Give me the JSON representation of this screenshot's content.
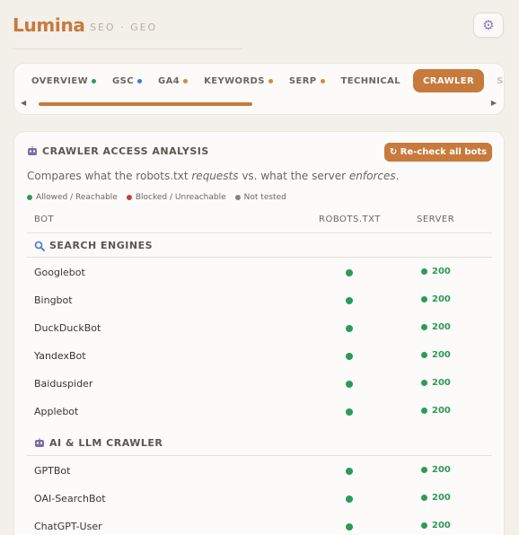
{
  "app": {
    "brand": "Lumina",
    "tagline": "SEO · GEO"
  },
  "tabs": [
    {
      "label": "OVERVIEW",
      "dot": "#2e9a57",
      "active": false
    },
    {
      "label": "GSC",
      "dot": "#3a7bd5",
      "active": false
    },
    {
      "label": "GA4",
      "dot": "#d28a3e",
      "active": false
    },
    {
      "label": "KEYWORDS",
      "dot": "#d28a3e",
      "active": false
    },
    {
      "label": "SERP",
      "dot": "#d28a3e",
      "active": false
    },
    {
      "label": "TECHNICAL",
      "dot": null,
      "active": false
    },
    {
      "label": "CRAWLER",
      "dot": null,
      "active": true
    },
    {
      "label": "SCI",
      "dot": null,
      "active": false
    }
  ],
  "tab_scroll": {
    "position": 0.45
  },
  "crawler": {
    "title": "CRAWLER ACCESS ANALYSIS",
    "recheck_button": "↻ Re-check all bots",
    "description_pre": "Compares what the robots.txt ",
    "description_requests": "requests",
    "description_mid": " vs. what the server ",
    "description_enforces": "enforces",
    "description_post": ".",
    "legend": [
      {
        "label": "Allowed / Reachable",
        "color": "#2e9a57"
      },
      {
        "label": "Blocked / Unreachable",
        "color": "#c0443a"
      },
      {
        "label": "Not tested",
        "color": "#8a837d"
      }
    ],
    "columns": {
      "bot": "BOT",
      "robots": "ROBOTS.TXT",
      "server": "SERVER"
    },
    "groups": [
      {
        "name": "SEARCH ENGINES",
        "icon": "magnifier-icon",
        "bots": [
          {
            "name": "Googlebot",
            "robots": "allowed",
            "server": "200"
          },
          {
            "name": "Bingbot",
            "robots": "allowed",
            "server": "200"
          },
          {
            "name": "DuckDuckBot",
            "robots": "allowed",
            "server": "200"
          },
          {
            "name": "YandexBot",
            "robots": "allowed",
            "server": "200"
          },
          {
            "name": "Baiduspider",
            "robots": "allowed",
            "server": "200"
          },
          {
            "name": "Applebot",
            "robots": "allowed",
            "server": "200"
          }
        ]
      },
      {
        "name": "AI & LLM CRAWLER",
        "icon": "robot-icon",
        "bots": [
          {
            "name": "GPTBot",
            "robots": "allowed",
            "server": "200"
          },
          {
            "name": "OAI-SearchBot",
            "robots": "allowed",
            "server": "200"
          },
          {
            "name": "ChatGPT-User",
            "robots": "allowed",
            "server": "200"
          }
        ]
      }
    ]
  },
  "colors": {
    "accent": "#c77a3c",
    "allowed": "#2e9a57",
    "blocked": "#c0443a",
    "untested": "#8a837d"
  }
}
